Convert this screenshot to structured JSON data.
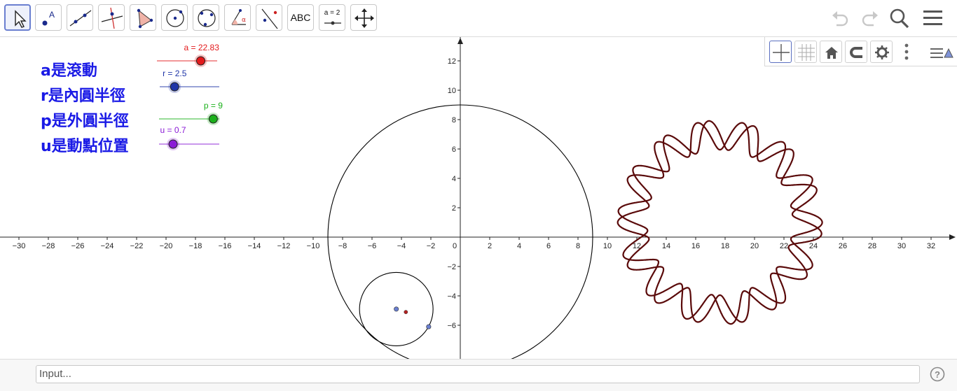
{
  "toolbar": {
    "tools": [
      {
        "name": "move-tool",
        "icon": "arrow-pointer-icon"
      },
      {
        "name": "point-tool",
        "icon": "point-icon",
        "glyph": "A"
      },
      {
        "name": "line-tool",
        "icon": "line-through-points-icon"
      },
      {
        "name": "perpendicular-line-tool",
        "icon": "perpendicular-line-icon"
      },
      {
        "name": "polygon-tool",
        "icon": "polygon-icon"
      },
      {
        "name": "circle-center-point-tool",
        "icon": "circle-center-icon"
      },
      {
        "name": "circle-three-points-tool",
        "icon": "circle-three-points-icon"
      },
      {
        "name": "angle-tool",
        "icon": "angle-icon",
        "glyph": "α"
      },
      {
        "name": "reflect-tool",
        "icon": "reflect-line-icon"
      },
      {
        "name": "text-tool",
        "icon": "text-icon",
        "glyph": "ABC"
      },
      {
        "name": "slider-tool",
        "icon": "slider-icon",
        "glyph": "a = 2"
      },
      {
        "name": "move-graphics-view-tool",
        "icon": "move-arrows-icon"
      }
    ],
    "right": [
      "undo-icon",
      "redo-icon",
      "search-icon",
      "menu-icon"
    ]
  },
  "labels": [
    "a是滾動",
    "r是內圓半徑",
    "p是外圓半徑",
    "u是動點位置"
  ],
  "sliders": [
    {
      "caption": "a = 22.83",
      "value": 22.83,
      "min": 0,
      "max": 31.4,
      "color": "#e31a1c"
    },
    {
      "caption": "r = 2.5",
      "value": 2.5,
      "min": 0,
      "max": 10,
      "color": "#1f35a8"
    },
    {
      "caption": "p = 9",
      "value": 9,
      "min": 0,
      "max": 10,
      "color": "#1ab01a"
    },
    {
      "caption": "u = 0.7",
      "value": 0.7,
      "min": 0,
      "max": 3,
      "color": "#8a1ad6"
    }
  ],
  "axes": {
    "x_ticks": [
      "−30",
      "−28",
      "−26",
      "−24",
      "−22",
      "−20",
      "−18",
      "−16",
      "−14",
      "−12",
      "−10",
      "−8",
      "−6",
      "−4",
      "−2",
      "0",
      "2",
      "4",
      "6",
      "8",
      "10",
      "12",
      "14",
      "16",
      "18",
      "20",
      "22",
      "24",
      "26",
      "28",
      "30",
      "32"
    ],
    "y_ticks": [
      "12",
      "10",
      "8",
      "6",
      "4",
      "2",
      "−2",
      "−4",
      "−6"
    ]
  },
  "stylebar": [
    "axes-toggle-icon",
    "grid-toggle-icon",
    "home-icon",
    "magnet-icon",
    "gear-icon",
    "more-options-icon",
    "toggle-stylebar-icon"
  ],
  "input": {
    "placeholder": "Input..."
  },
  "colors": {
    "curve": "#5a0a0a",
    "circle": "#000000",
    "point_blue": "#6a7fd0",
    "point_red": "#b02020"
  }
}
